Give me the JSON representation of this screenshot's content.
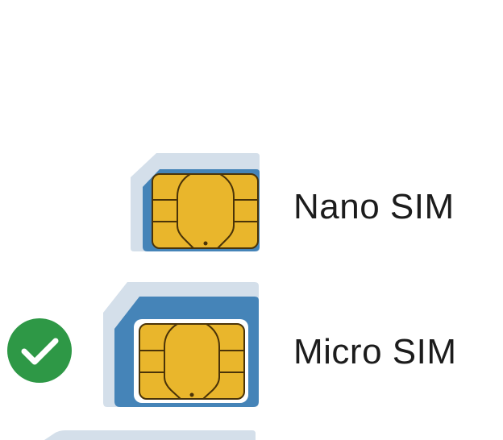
{
  "colors": {
    "check_green": "#2e9846",
    "sim_blue": "#4584b8",
    "sim_shadow": "#d4dfea",
    "chip_gold": "#e9b62c",
    "chip_line": "#4a3308"
  },
  "options": [
    {
      "label": "Nano SIM",
      "selected": false,
      "icon": "nano-sim-icon"
    },
    {
      "label": "Micro SIM",
      "selected": true,
      "icon": "micro-sim-icon"
    },
    {
      "label": "",
      "selected": false,
      "icon": "mini-sim-icon"
    }
  ],
  "selected_indicator_icon": "checkmark-circle-icon"
}
